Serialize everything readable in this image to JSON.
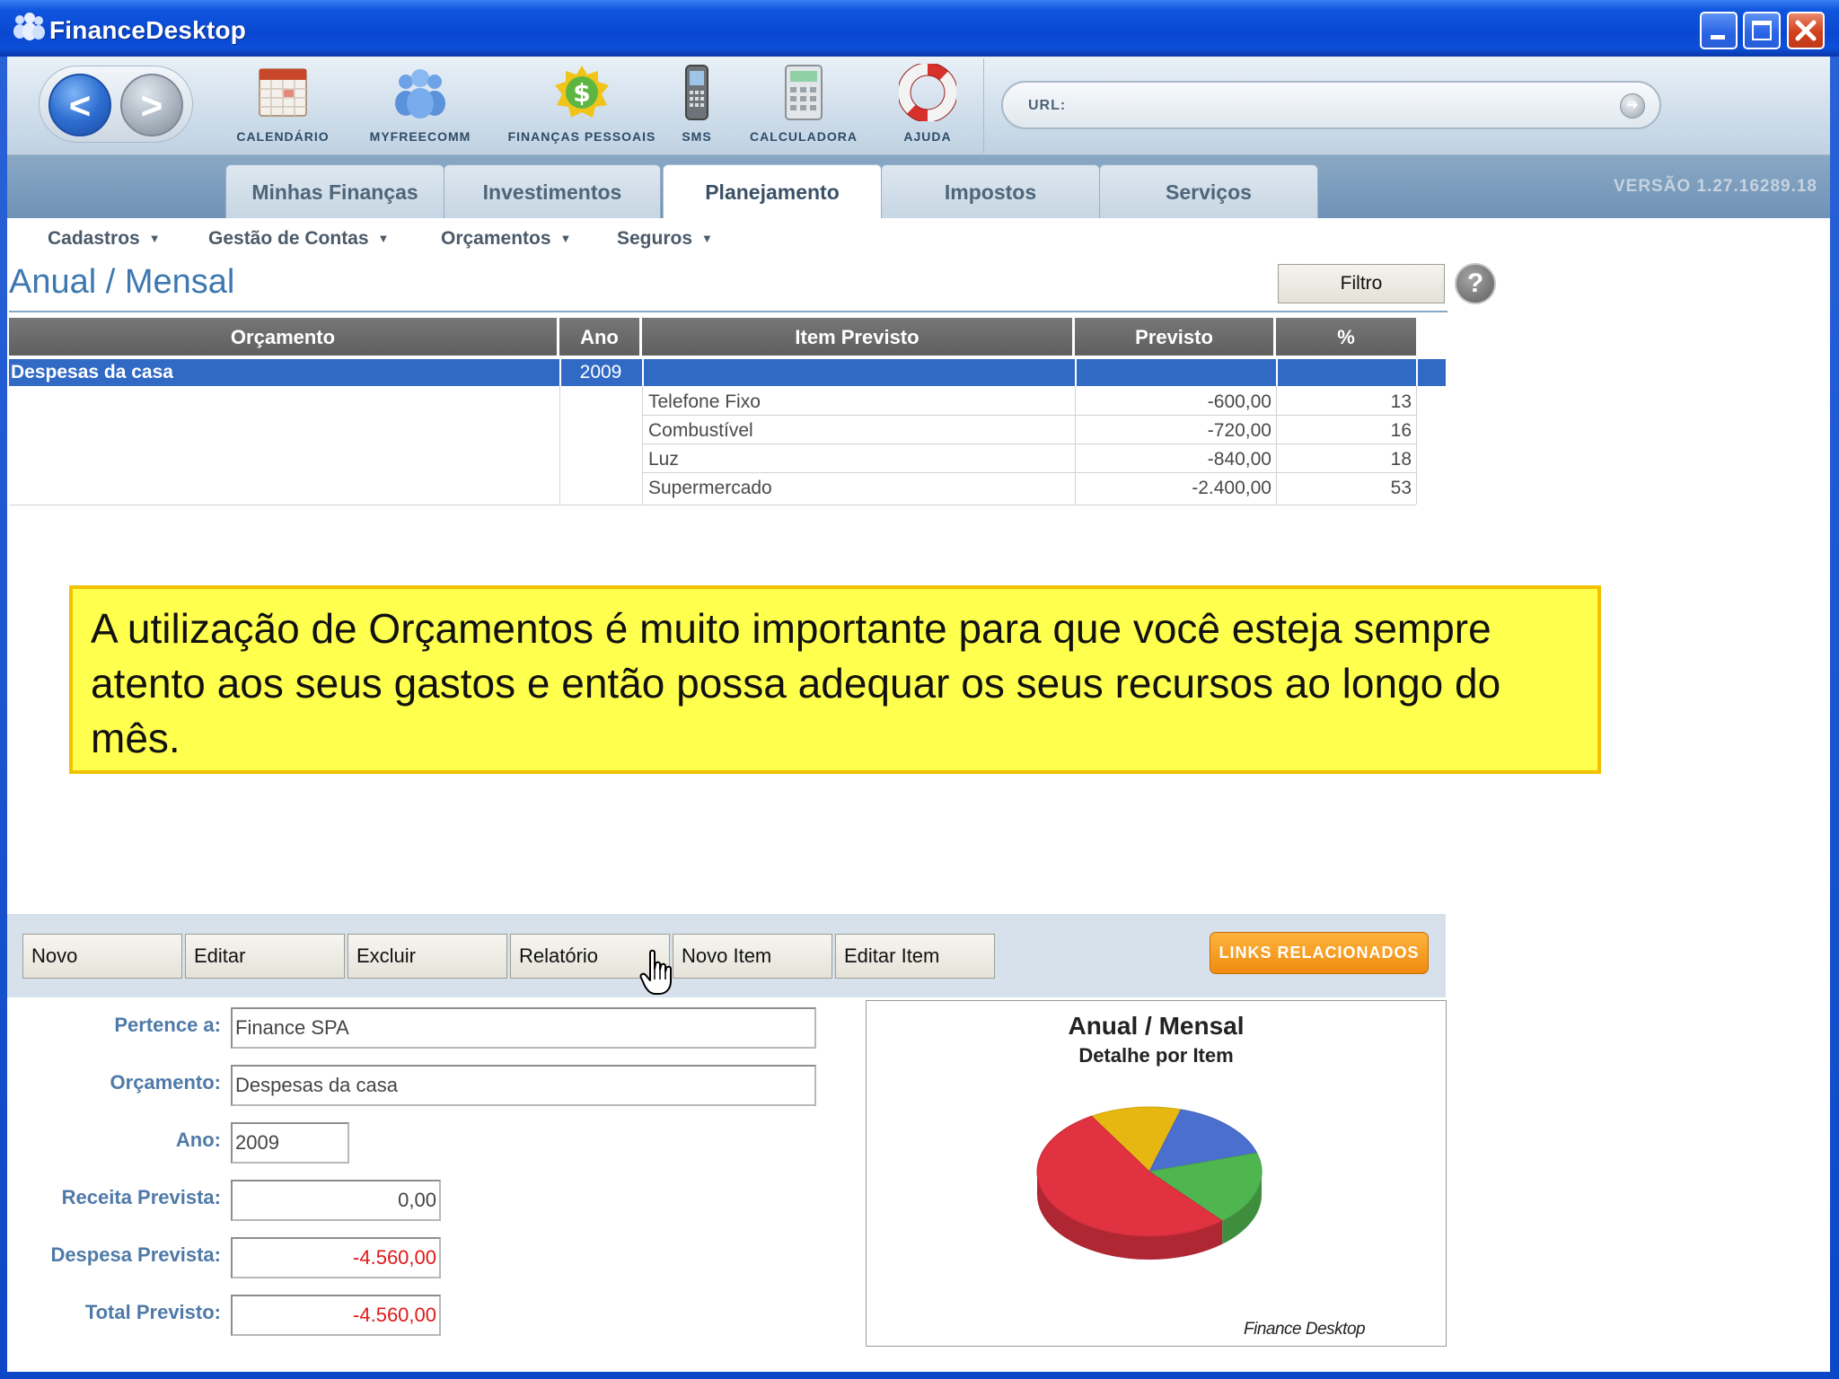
{
  "window": {
    "title": "FinanceDesktop"
  },
  "toolbar": {
    "tools": [
      {
        "label": "CALENDÁRIO",
        "icon": "calendar-icon"
      },
      {
        "label": "MYFREECOMM",
        "icon": "people-icon"
      },
      {
        "label": "FINANÇAS PESSOAIS",
        "icon": "money-icon"
      },
      {
        "label": "SMS",
        "icon": "phone-icon"
      },
      {
        "label": "CALCULADORA",
        "icon": "calculator-icon"
      },
      {
        "label": "AJUDA",
        "icon": "lifebuoy-icon"
      }
    ],
    "url_label": "URL:",
    "url_value": ""
  },
  "tabs": {
    "items": [
      {
        "label": "Minhas Finanças"
      },
      {
        "label": "Investimentos"
      },
      {
        "label": "Planejamento"
      },
      {
        "label": "Impostos"
      },
      {
        "label": "Serviços"
      }
    ],
    "active": "Planejamento",
    "version": "VERSÃO 1.27.16289.18"
  },
  "submenu": {
    "items": [
      {
        "label": "Cadastros"
      },
      {
        "label": "Gestão de Contas"
      },
      {
        "label": "Orçamentos"
      },
      {
        "label": "Seguros"
      }
    ]
  },
  "page": {
    "title": "Anual / Mensal",
    "filter_button": "Filtro",
    "help_icon": "?"
  },
  "grid": {
    "columns": [
      "Orçamento",
      "Ano",
      "Item Previsto",
      "Previsto",
      "%"
    ],
    "selected_row": {
      "orcamento": "Despesas da casa",
      "ano": "2009"
    },
    "items": [
      {
        "item": "Telefone Fixo",
        "previsto": "-600,00",
        "pct": "13"
      },
      {
        "item": "Combustível",
        "previsto": "-720,00",
        "pct": "16"
      },
      {
        "item": "Luz",
        "previsto": "-840,00",
        "pct": "18"
      },
      {
        "item": "Supermercado",
        "previsto": "-2.400,00",
        "pct": "53"
      }
    ]
  },
  "note": {
    "text": "A utilização de Orçamentos é muito importante para que você esteja sempre atento aos seus gastos e então possa adequar os seus recursos ao longo do mês."
  },
  "actions": {
    "novo": "Novo",
    "editar": "Editar",
    "excluir": "Excluir",
    "relatorio": "Relatório",
    "novo_item": "Novo Item",
    "editar_item": "Editar Item",
    "links": "LINKS RELACIONADOS"
  },
  "form": {
    "pertence_label": "Pertence a:",
    "pertence_value": "Finance SPA",
    "orcamento_label": "Orçamento:",
    "orcamento_value": "Despesas da casa",
    "ano_label": "Ano:",
    "ano_value": "2009",
    "receita_label": "Receita Prevista:",
    "receita_value": "0,00",
    "despesa_label": "Despesa Prevista:",
    "despesa_value": "-4.560,00",
    "total_label": "Total Previsto:",
    "total_value": "-4.560,00"
  },
  "chart": {
    "title": "Anual / Mensal",
    "subtitle": "Detalhe por Item",
    "brand": "Finance Desktop"
  },
  "chart_data": {
    "type": "pie",
    "title": "Anual / Mensal",
    "subtitle": "Detalhe por Item",
    "categories": [
      "Telefone Fixo",
      "Combustível",
      "Luz",
      "Supermercado"
    ],
    "values": [
      600,
      720,
      840,
      2400
    ],
    "colors": [
      "#e6b710",
      "#4a6fcf",
      "#4fb64f",
      "#e03241"
    ]
  },
  "colors": {
    "selection": "#316ac5",
    "note_bg": "#ffff4d",
    "note_border": "#f2c200",
    "negative": "#e01818",
    "links_button": "#f59a1b"
  }
}
